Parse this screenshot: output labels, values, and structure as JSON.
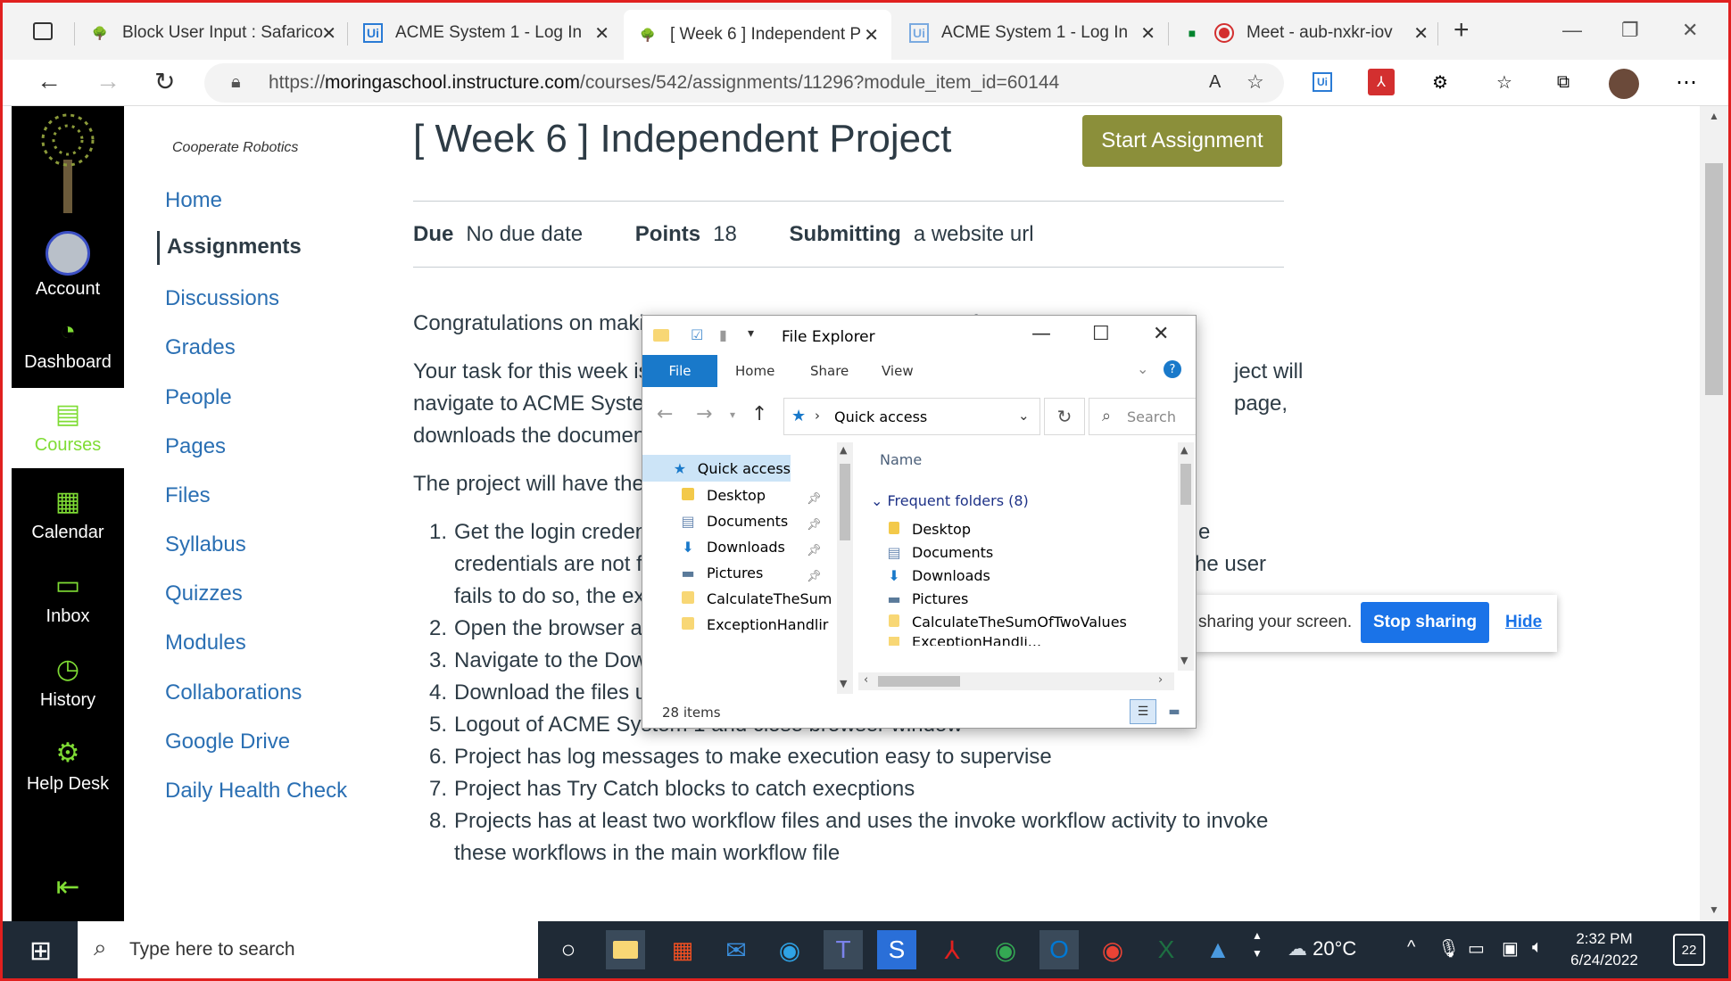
{
  "browser": {
    "tabs": [
      {
        "title": "Block User Input : Safarico"
      },
      {
        "title": "ACME System 1 - Log In",
        "icon_text": "Ui"
      },
      {
        "title": "[ Week 6 ] Independent P"
      },
      {
        "title": "ACME System 1 - Log In",
        "icon_text": "Ui"
      },
      {
        "title": "Meet - aub-nxkr-iov"
      }
    ],
    "url_prefix": "https://",
    "url_host": "moringaschool.instructure.com",
    "url_path": "/courses/542/assignments/11296?module_item_id=60144",
    "ext_ui": "Ui"
  },
  "global_nav": {
    "items": [
      {
        "label": "Account"
      },
      {
        "label": "Dashboard"
      },
      {
        "label": "Courses"
      },
      {
        "label": "Calendar"
      },
      {
        "label": "Inbox"
      },
      {
        "label": "History"
      },
      {
        "label": "Help Desk"
      }
    ]
  },
  "course_nav": {
    "breadcrumb": "Cooperate Robotics",
    "items": [
      "Home",
      "Assignments",
      "Discussions",
      "Grades",
      "People",
      "Pages",
      "Files",
      "Syllabus",
      "Quizzes",
      "Modules",
      "Collaborations",
      "Google Drive",
      "Daily Health Check"
    ]
  },
  "assignment": {
    "title": "[ Week 6 ] Independent Project",
    "start_button": "Start Assignment",
    "due_label": "Due",
    "due_value": "No due date",
    "points_label": "Points",
    "points_value": "18",
    "submitting_label": "Submitting",
    "submitting_value": "a website url",
    "p1": "Congratulations on maki",
    "p1_tail": "f",
    "p2_line1": "Your task for this week is",
    "p2_line1_tail": "ject will",
    "p2_line2": "navigate to ACME Syster",
    "p2_line2_tail": "page,",
    "p2_line3": "downloads the documen",
    "p3": "The project will have the",
    "list": [
      {
        "num": "1.",
        "text": "Get the login credent",
        "tail": "e"
      },
      {
        "cont": "credentials are not fo",
        "tail": "he user"
      },
      {
        "cont": "fails to do so, the exe"
      },
      {
        "num": "2.",
        "text": "Open the browser ar"
      },
      {
        "num": "3.",
        "text": "Navigate to the Dow"
      },
      {
        "num": "4.",
        "text": "Download the files u"
      },
      {
        "num": "5.",
        "text": "Logout of ACME System 1 and close browser window"
      },
      {
        "num": "6.",
        "text": "Project has log messages to make execution easy to supervise"
      },
      {
        "num": "7.",
        "text": "Project has Try Catch blocks to catch execptions"
      },
      {
        "num": "8.",
        "text": "Projects has at least two workflow files and uses the invoke workflow activity to invoke"
      },
      {
        "cont": "these workflows in the main workflow file"
      }
    ]
  },
  "sharing": {
    "text": "sharing your screen.",
    "stop": "Stop sharing",
    "hide": "Hide"
  },
  "file_explorer": {
    "title": "File Explorer",
    "ribbon": {
      "file": "File",
      "home": "Home",
      "share": "Share",
      "view": "View"
    },
    "address": "Quick access",
    "search_placeholder": "Search",
    "nav": [
      {
        "label": "Quick access"
      },
      {
        "label": "Desktop"
      },
      {
        "label": "Documents"
      },
      {
        "label": "Downloads"
      },
      {
        "label": "Pictures"
      },
      {
        "label": "CalculateTheSum"
      },
      {
        "label": "ExceptionHandlir"
      }
    ],
    "column_name": "Name",
    "group": "Frequent folders (8)",
    "items": [
      "Desktop",
      "Documents",
      "Downloads",
      "Pictures",
      "CalculateTheSumOfTwoValues",
      "ExceptionHandli..."
    ],
    "status": "28 items"
  },
  "taskbar": {
    "search_placeholder": "Type here to search",
    "temperature": "20°C",
    "time": "2:32 PM",
    "date": "6/24/2022",
    "notifications": "22"
  }
}
